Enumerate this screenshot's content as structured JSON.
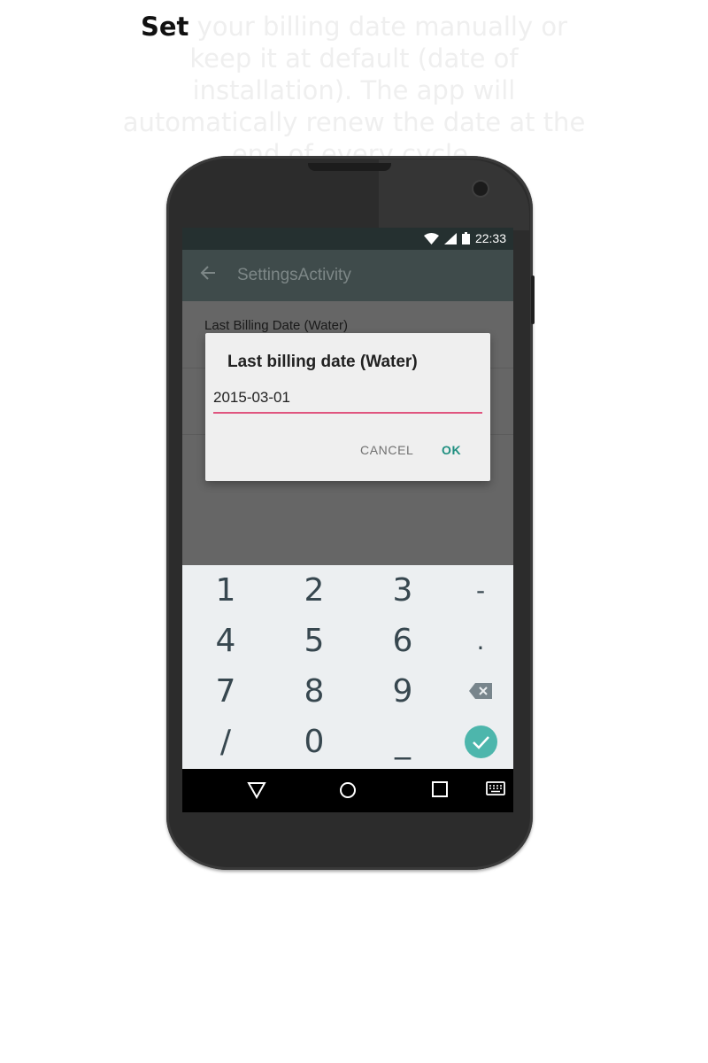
{
  "caption": {
    "lead": "Set",
    "rest": " your billing date manually or keep it at default (date of installation). The app will automatically renew the date at the end of every cycle."
  },
  "status_bar": {
    "time": "22:33",
    "icons": [
      "wifi-icon",
      "signal-icon",
      "battery-icon"
    ]
  },
  "app_bar": {
    "back_icon": "arrow-back-icon",
    "title": "SettingsActivity"
  },
  "preference": {
    "title": "Last Billing Date (Water)"
  },
  "dialog": {
    "title": "Last billing date (Water)",
    "input_value": "2015-03-01",
    "cancel_label": "CANCEL",
    "ok_label": "OK",
    "accent_color": "#e0557f",
    "ok_color": "#1f8f80"
  },
  "keypad": {
    "rows": [
      [
        "1",
        "2",
        "3",
        "-"
      ],
      [
        "4",
        "5",
        "6",
        "."
      ],
      [
        "7",
        "8",
        "9",
        "backspace-icon"
      ],
      [
        "/",
        "0",
        "_",
        "done-check-icon"
      ]
    ],
    "done_color": "#4db6ac"
  },
  "nav_bar": {
    "icons": [
      "back-triangle-icon",
      "home-circle-icon",
      "recents-square-icon",
      "keyboard-icon"
    ]
  }
}
